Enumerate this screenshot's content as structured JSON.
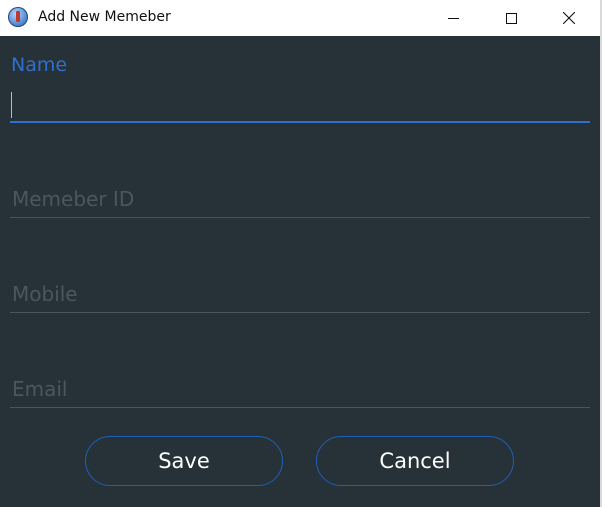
{
  "window": {
    "title": "Add New Memeber",
    "app_icon": "app-icon",
    "controls": {
      "minimize_icon": "minimize-icon",
      "maximize_icon": "maximize-icon",
      "close_icon": "close-icon"
    }
  },
  "form": {
    "name": {
      "label": "Name",
      "value": "",
      "focused": true
    },
    "member_id": {
      "placeholder": "Memeber ID",
      "value": ""
    },
    "mobile": {
      "placeholder": "Mobile",
      "value": ""
    },
    "email": {
      "placeholder": "Email",
      "value": ""
    }
  },
  "buttons": {
    "save_label": "Save",
    "cancel_label": "Cancel"
  },
  "colors": {
    "background": "#263238",
    "accent": "#2f6fcf",
    "button_border": "#1f5fb8",
    "placeholder": "#4b575c",
    "titlebar": "#ffffff"
  }
}
